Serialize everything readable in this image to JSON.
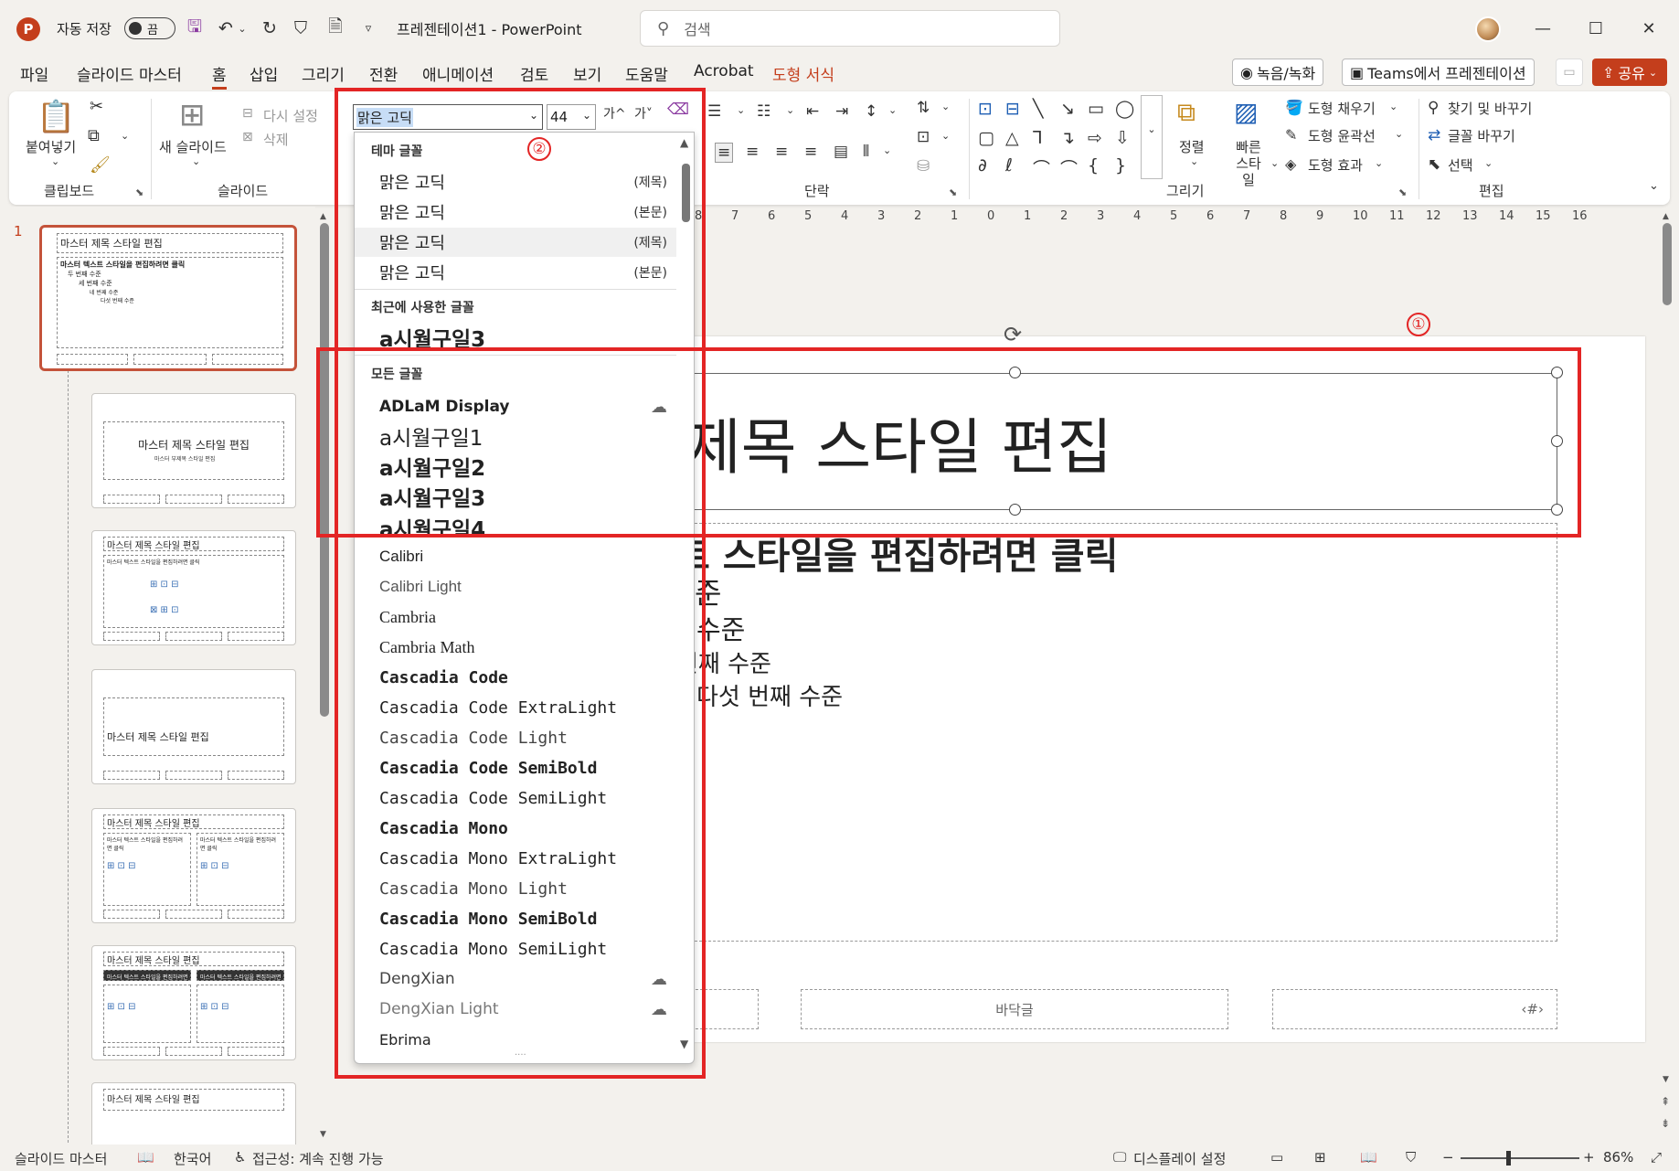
{
  "app": {
    "logo": "P",
    "title": "프레젠테이션1  -  PowerPoint",
    "search_placeholder": "검색"
  },
  "autosave": {
    "label": "자동 저장",
    "state": "끔"
  },
  "menu_tabs": [
    "파일",
    "슬라이드 마스터",
    "홈",
    "삽입",
    "그리기",
    "전환",
    "애니메이션",
    "검토",
    "보기",
    "도움말",
    "Acrobat",
    "도형 서식"
  ],
  "active_tab": "홈",
  "right_buttons": {
    "record": "녹음/녹화",
    "teams": "Teams에서 프레젠테이션",
    "share": "공유"
  },
  "ribbon": {
    "clipboard": {
      "paste": "붙여넣기",
      "label": "클립보드"
    },
    "slides": {
      "new_slide": "새 슬라이드",
      "reset": "다시 설정",
      "delete": "삭제",
      "label": "슬라이드"
    },
    "font": {
      "name": "맑은 고딕",
      "size": "44",
      "grow": "가^",
      "shrink": "가˅"
    },
    "paragraph": {
      "label": "단락"
    },
    "drawing": {
      "label": "그리기",
      "arrange": "정렬",
      "quick_styles": "빠른 스타일",
      "fill": "도형 채우기",
      "outline": "도형 윤곽선",
      "effects": "도형 효과"
    },
    "editing": {
      "find_replace": "찾기 및 바꾸기",
      "replace_font": "글꼴 바꾸기",
      "select": "선택",
      "label": "편집"
    }
  },
  "font_dropdown": {
    "theme_header": "테마 글꼴",
    "theme_fonts": [
      {
        "name": "맑은 고딕",
        "role": "(제목)"
      },
      {
        "name": "맑은 고딕",
        "role": "(본문)"
      },
      {
        "name": "맑은 고딕",
        "role": "(제목)"
      },
      {
        "name": "맑은 고딕",
        "role": "(본문)"
      }
    ],
    "recent_header": "최근에 사용한 글꼴",
    "recent_fonts": [
      "a시월구일3"
    ],
    "all_header": "모든 글꼴",
    "all_fonts": [
      "ADLaM Display",
      "a시월구일1",
      "a시월구일2",
      "a시월구일3",
      "a시월구일4",
      "Calibri",
      "Calibri Light",
      "Cambria",
      "Cambria Math",
      "Cascadia Code",
      "Cascadia Code ExtraLight",
      "Cascadia Code Light",
      "Cascadia Code SemiBold",
      "Cascadia Code SemiLight",
      "Cascadia Mono",
      "Cascadia Mono ExtraLight",
      "Cascadia Mono Light",
      "Cascadia Mono SemiBold",
      "Cascadia Mono SemiLight",
      "DengXian",
      "DengXian Light",
      "Ebrima"
    ]
  },
  "slide": {
    "title": "제목 스타일 편집",
    "body_lines": [
      "트 스타일을 편집하려면 클릭",
      "준",
      "수준",
      "번째 수준",
      "다섯 번째 수준"
    ],
    "footer": "바닥글",
    "page_number": "‹#›"
  },
  "ruler_ticks": [
    "8",
    "7",
    "6",
    "5",
    "4",
    "3",
    "2",
    "1",
    "0",
    "1",
    "2",
    "3",
    "4",
    "5",
    "6",
    "7",
    "8",
    "9",
    "10",
    "11",
    "12",
    "13",
    "14",
    "15",
    "16"
  ],
  "thumbnails": {
    "slide_number": "1",
    "master_title": "마스터 제목 스타일 편집",
    "master_text": "마스터 텍스트 스타일을 편집하려면 클릭",
    "levels": [
      "두 번째 수준",
      "세 번째 수준",
      "네 번째 수준",
      "다섯 번째 수준"
    ],
    "subtitle_short": "마스터 부제목 스타일 편집"
  },
  "annotations": {
    "one": "①",
    "two": "②"
  },
  "status": {
    "view": "슬라이드 마스터",
    "language": "한국어",
    "accessibility": "접근성: 계속 진행 가능",
    "display": "디스플레이 설정",
    "zoom": "86%"
  },
  "colors": {
    "accent": "#c43e1c",
    "annotation": "#e32525"
  }
}
